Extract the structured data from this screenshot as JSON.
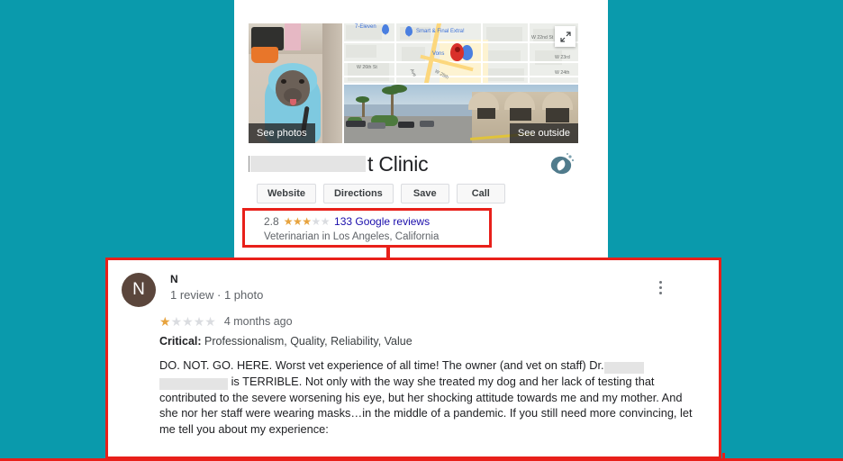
{
  "theme": {
    "background": "#0a9aac",
    "highlight_border": "#e8201a",
    "link_blue": "#1a0dab",
    "star_gold": "#e7a33e",
    "avatar_bg": "#5b463c"
  },
  "knowledge_panel": {
    "media": {
      "photo_caption": "See photos",
      "outside_caption": "See outside",
      "expand_icon": "expand-icon",
      "map": {
        "pois": [
          "7-Eleven",
          "Smart & Final Extra!",
          "Vons"
        ],
        "street_labels": [
          "W 22nd St",
          "W 23rd",
          "W 24th",
          "W 26th St",
          "W 25th",
          "Ave"
        ]
      }
    },
    "title": {
      "redacted_name": "",
      "visible_suffix": "t Clinic",
      "logo_icon": "dolphin-logo-icon"
    },
    "actions": [
      {
        "label": "Website"
      },
      {
        "label": "Directions"
      },
      {
        "label": "Save"
      },
      {
        "label": "Call"
      }
    ],
    "rating": {
      "score": "2.8",
      "stars_filled": 3,
      "stars_total": 5,
      "review_count_label": "133 Google reviews",
      "category": "Veterinarian in Los Angeles, California"
    }
  },
  "review": {
    "avatar_initial": "N",
    "author": "N",
    "meta": "1 review · 1 photo",
    "stars_filled": 1,
    "stars_total": 5,
    "age": "4 months ago",
    "critical_label": "Critical:",
    "critical_tags": "Professionalism, Quality, Reliability, Value",
    "menu_icon": "more-vertical-icon",
    "body_part1": "DO. NOT. GO. HERE. Worst vet experience of all time! The owner (and vet on staff) Dr.",
    "body_part2": "is TERRIBLE. Not only with the way she treated my dog and her lack of testing that contributed to the severe worsening his eye, but her shocking attitude towards me and my mother. And she nor her staff were wearing masks…in the middle of a pandemic. If you still need more convincing, let me tell you about my experience:"
  }
}
